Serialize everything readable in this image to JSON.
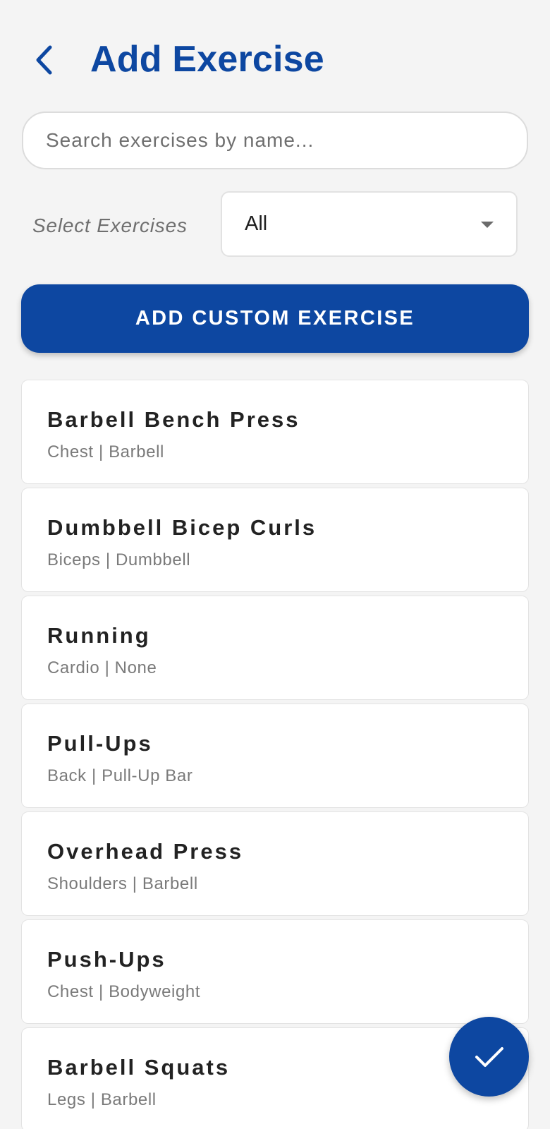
{
  "header": {
    "title": "Add Exercise",
    "back_icon": "chevron-left-icon"
  },
  "search": {
    "placeholder": "Search exercises by name...",
    "value": ""
  },
  "filter": {
    "label": "Select Exercises",
    "selected": "All"
  },
  "add_custom": {
    "label": "ADD CUSTOM EXERCISE"
  },
  "exercises": [
    {
      "name": "Barbell Bench Press",
      "meta": "Chest | Barbell"
    },
    {
      "name": "Dumbbell Bicep Curls",
      "meta": "Biceps | Dumbbell"
    },
    {
      "name": "Running",
      "meta": "Cardio | None"
    },
    {
      "name": "Pull-Ups",
      "meta": "Back | Pull-Up Bar"
    },
    {
      "name": "Overhead Press",
      "meta": "Shoulders | Barbell"
    },
    {
      "name": "Push-Ups",
      "meta": "Chest | Bodyweight"
    },
    {
      "name": "Barbell Squats",
      "meta": "Legs | Barbell"
    }
  ],
  "fab": {
    "icon": "check-icon"
  },
  "colors": {
    "primary": "#0d47a1",
    "background": "#f4f4f4",
    "card": "#ffffff",
    "text_primary": "#222222",
    "text_secondary": "#7a7a7a"
  }
}
